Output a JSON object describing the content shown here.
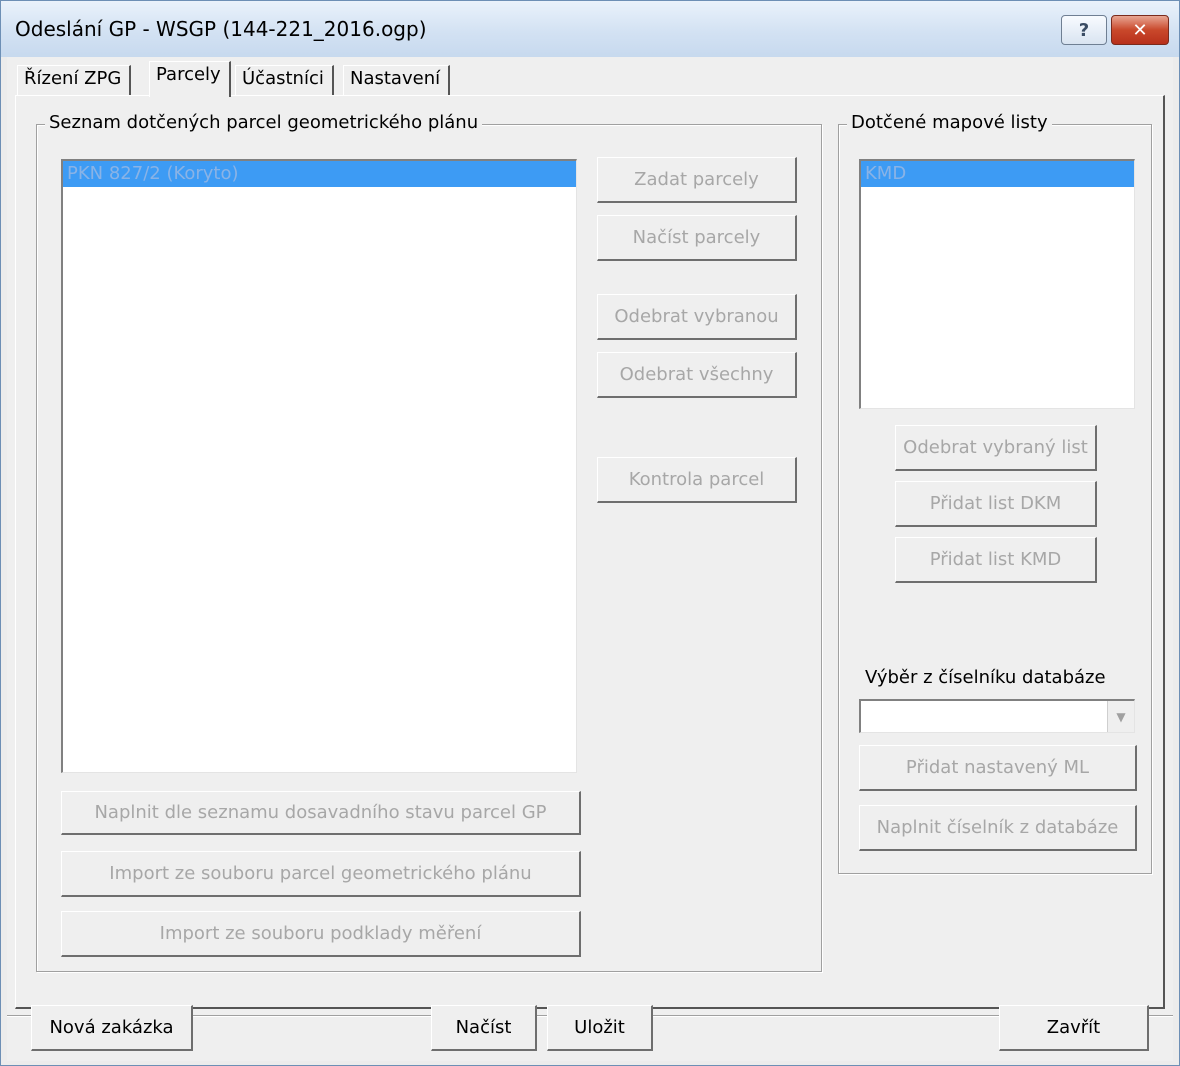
{
  "window": {
    "title": "Odeslání GP - WSGP  (144-221_2016.ogp)",
    "help_glyph": "?",
    "close_glyph": "✕"
  },
  "tabs": [
    "Řízení ZPG",
    "Parcely",
    "Účastníci",
    "Nastavení"
  ],
  "parcels_group": {
    "title": "Seznam dotčených parcel geometrického plánu",
    "items": [
      "PKN 827/2  (Koryto)"
    ],
    "buttons": {
      "zadat": "Zadat parcely",
      "nacist": "Načíst parcely",
      "odebrat_vybranou": "Odebrat vybranou",
      "odebrat_vsechny": "Odebrat všechny",
      "kontrola": "Kontrola parcel",
      "naplnit": "Naplnit dle seznamu dosavadního stavu parcel GP",
      "import_gp": "Import ze souboru parcel geometrického plánu",
      "import_mereni": "Import ze souboru podklady měření"
    }
  },
  "maps_group": {
    "title": "Dotčené mapové listy",
    "items": [
      "KMD"
    ],
    "buttons": {
      "odebrat_list": "Odebrat vybraný list",
      "pridat_dkm": "Přidat list DKM",
      "pridat_kmd": "Přidat list KMD",
      "pridat_ml": "Přidat nastavený ML",
      "naplnit_ciselnik": "Naplnit číselník z databáze"
    },
    "combo_label": "Výběr z číselníku databáze",
    "combo_value": ""
  },
  "footer": {
    "nova": "Nová zakázka",
    "nacist": "Načíst",
    "ulozit": "Uložit",
    "zavrit": "Zavřít"
  }
}
